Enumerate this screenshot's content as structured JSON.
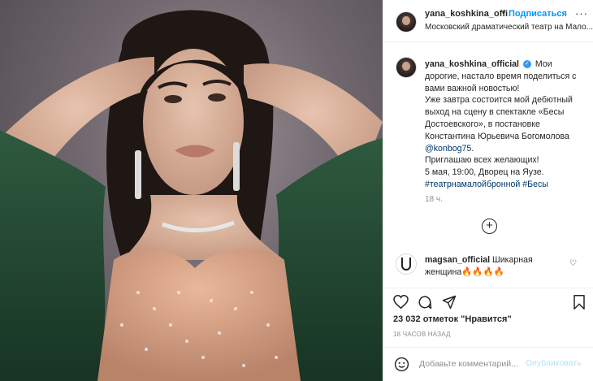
{
  "post": {
    "username": "yana_koshkina_offi",
    "dot": "•",
    "follow_label": "Подписаться",
    "more_icon": "···",
    "location": "Московский драматический театр на Мало..."
  },
  "caption": {
    "author": "yana_koshkina_official",
    "verified_mark": "✓",
    "line1": "Мои дорогие, настало время поделиться с вами важной новостью!",
    "line2": "Уже завтра состоится мой дебютный выход на сцену в спектакле «Бесы Достоевского», в постановке Константина Юрьевича Богомолова",
    "mention": "@konbog75",
    "mention_tail": ".",
    "line3": "Приглашаю всех желающих!",
    "line4": "5 мая, 19:00, Дворец на Яузе.",
    "hashtags": "#театрнамалойбронной #Бесы",
    "time": "18 ч."
  },
  "load_more_icon": "+",
  "comment": {
    "author": "magsan_official",
    "text": "Шикарная женщина🔥🔥🔥🔥",
    "heart_icon": "♡"
  },
  "stats": {
    "likes": "23 032 отметок \"Нравится\"",
    "ago": "18 ЧАСОВ НАЗАД"
  },
  "add_comment": {
    "placeholder": "Добавьте комментарий...",
    "publish_label": "Опубликовать"
  },
  "icons": [
    "heart-icon",
    "comment-icon",
    "share-icon",
    "bookmark-icon",
    "emoji-icon",
    "plus-circle-icon",
    "more-icon",
    "verified-icon"
  ],
  "colors": {
    "accent": "#0095f6",
    "link": "#00376b",
    "muted": "#8e8e8e",
    "text": "#262626",
    "publish_disabled": "#b2dffc"
  }
}
